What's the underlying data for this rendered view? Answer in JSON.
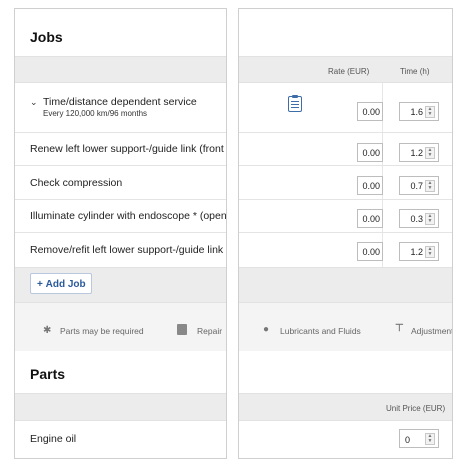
{
  "jobs": {
    "title": "Jobs",
    "columns": {
      "rate": "Rate (EUR)",
      "time": "Time (h)"
    },
    "rows": [
      {
        "label": "Time/distance dependent service",
        "sublabel": "Every 120,000 km/96 months",
        "rate": "0.00",
        "time": "1.6",
        "expanded": true,
        "doc_icon": "clipboard-icon"
      },
      {
        "label": "Renew left lower support-/guide link (front axle)",
        "rate": "0.00",
        "time": "1.2"
      },
      {
        "label": "Check compression",
        "rate": "0.00",
        "time": "0.7"
      },
      {
        "label": "Illuminate cylinder with endoscope * (opening)",
        "rate": "0.00",
        "time": "0.3"
      },
      {
        "label": "Remove/refit left lower support-/guide link (front axle)",
        "rate": "0.00",
        "time": "1.2"
      }
    ],
    "add_label": "Add Job",
    "add_icon": "plus-icon"
  },
  "legend": {
    "items": [
      {
        "icon": "asterisk-icon",
        "label": "Parts may be required"
      },
      {
        "icon": "repair-icon",
        "label": "Repair"
      },
      {
        "icon": "drop-icon",
        "label": "Lubricants and Fluids"
      },
      {
        "icon": "wrench-icon",
        "label": "Adjustments"
      }
    ]
  },
  "parts": {
    "title": "Parts",
    "columns": {
      "unit_price": "Unit Price (EUR)"
    },
    "rows": [
      {
        "label": "Engine oil",
        "unit_price": "0"
      }
    ]
  },
  "colors": {
    "accent": "#2a5a9a",
    "band": "#ececec",
    "panel_bg": "#f4f4f4"
  }
}
